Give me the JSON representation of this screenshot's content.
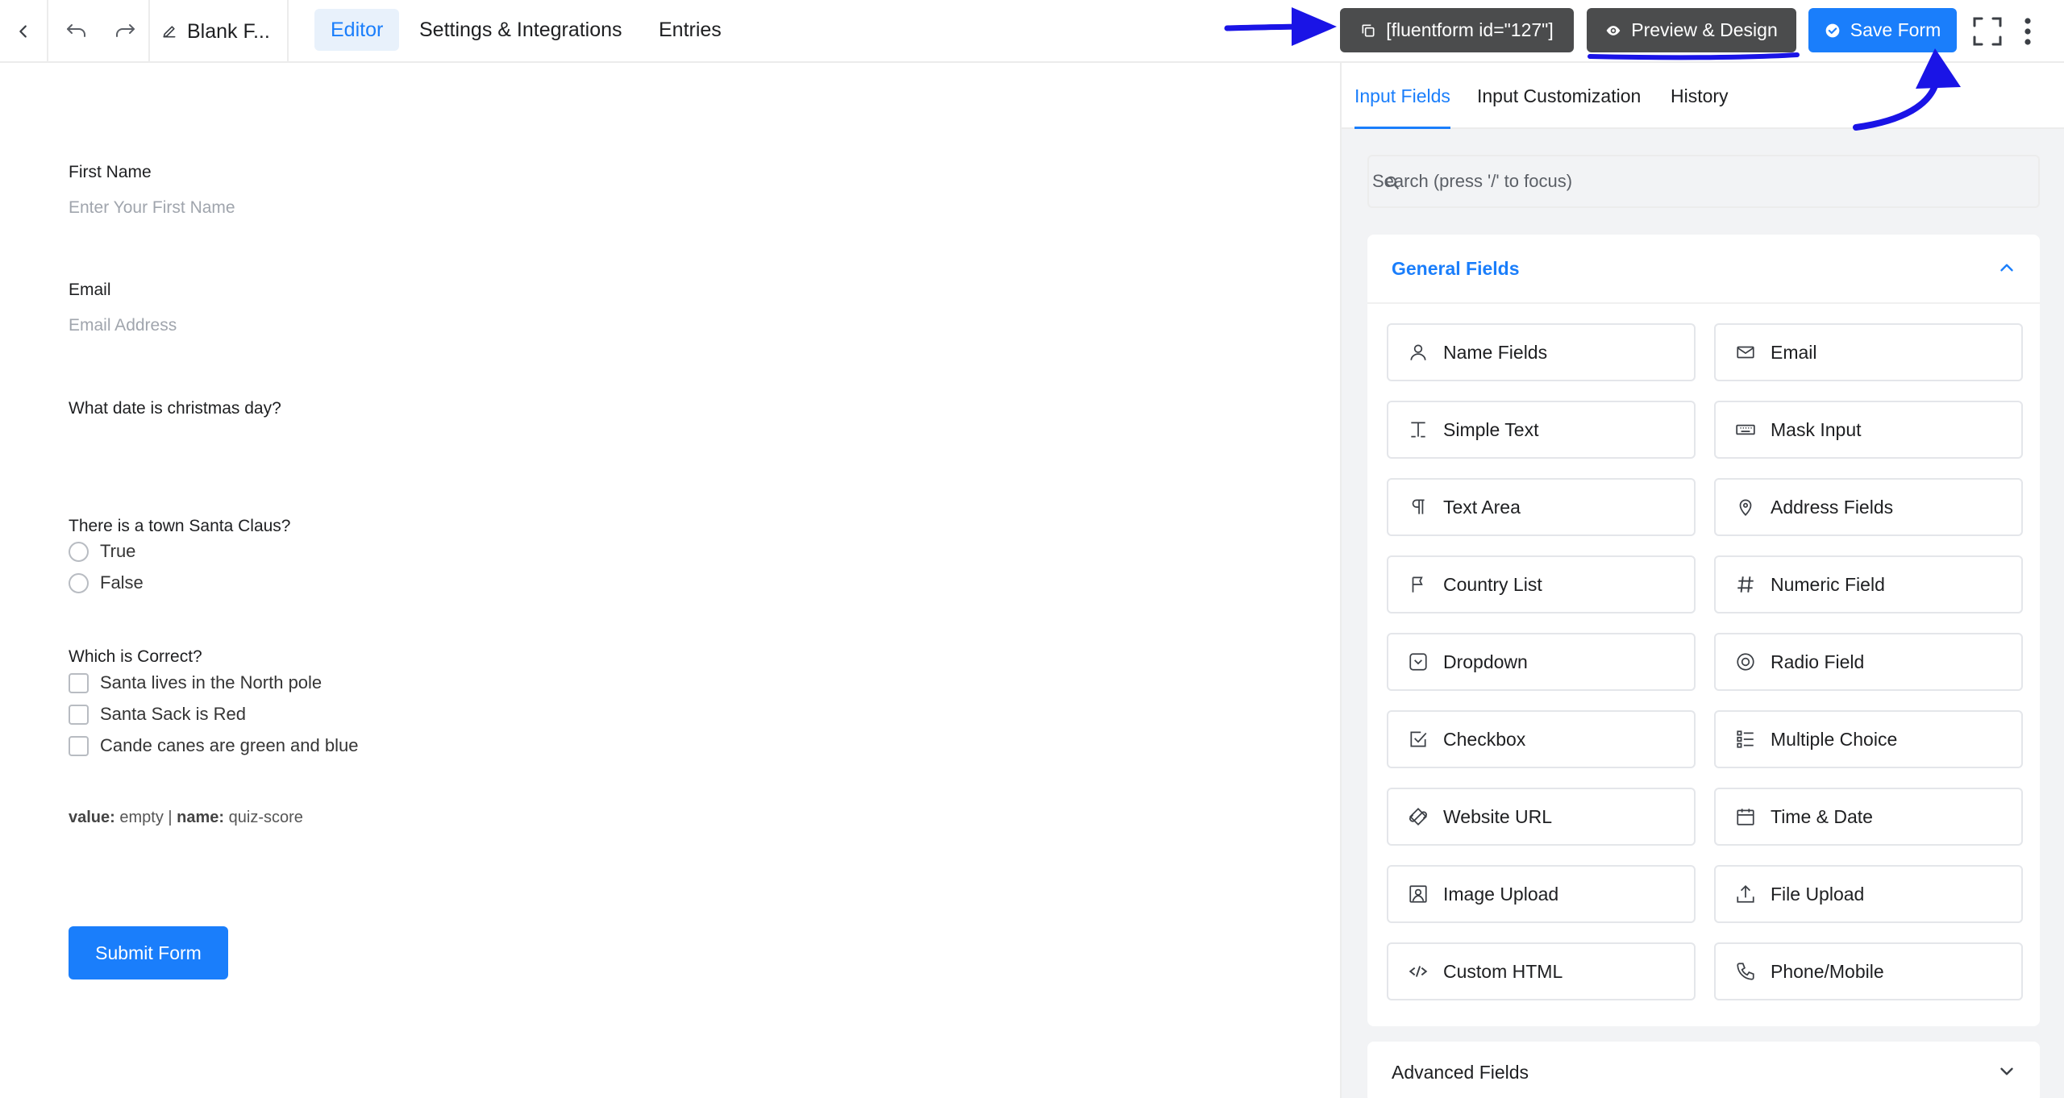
{
  "topbar": {
    "form_title": "Blank F...",
    "tabs": [
      {
        "label": "Editor"
      },
      {
        "label": "Settings & Integrations"
      },
      {
        "label": "Entries"
      }
    ],
    "shortcode": "[fluentform id=\"127\"]",
    "preview_label": "Preview & Design",
    "save_label": "Save Form"
  },
  "form": {
    "first_name": {
      "label": "First Name",
      "placeholder": "Enter Your First Name"
    },
    "email": {
      "label": "Email",
      "placeholder": "Email Address"
    },
    "date_question": {
      "label": "What date is christmas day?"
    },
    "radio_question": {
      "label": "There is a town Santa Claus?",
      "options": [
        "True",
        "False"
      ]
    },
    "checkbox_question": {
      "label": "Which is Correct?",
      "options": [
        "Santa lives in the North pole",
        "Santa Sack is Red",
        "Cande canes are green and blue"
      ]
    },
    "hidden_info": {
      "value_key": "value:",
      "value": "empty",
      "sep": "|",
      "name_key": "name:",
      "name": "quiz-score"
    },
    "submit_label": "Submit Form"
  },
  "sidebar": {
    "tabs": [
      {
        "label": "Input Fields"
      },
      {
        "label": "Input Customization"
      },
      {
        "label": "History"
      }
    ],
    "search_placeholder": "Search (press '/' to focus)",
    "general_title": "General Fields",
    "fields": [
      {
        "label": "Name Fields",
        "icon": "user-icon"
      },
      {
        "label": "Email",
        "icon": "envelope-icon"
      },
      {
        "label": "Simple Text",
        "icon": "text-cursor-icon"
      },
      {
        "label": "Mask Input",
        "icon": "keyboard-icon"
      },
      {
        "label": "Text Area",
        "icon": "paragraph-icon"
      },
      {
        "label": "Address Fields",
        "icon": "map-pin-icon"
      },
      {
        "label": "Country List",
        "icon": "flag-icon"
      },
      {
        "label": "Numeric Field",
        "icon": "hash-icon"
      },
      {
        "label": "Dropdown",
        "icon": "dropdown-icon"
      },
      {
        "label": "Radio Field",
        "icon": "radio-icon"
      },
      {
        "label": "Checkbox",
        "icon": "checkbox-icon"
      },
      {
        "label": "Multiple Choice",
        "icon": "list-icon"
      },
      {
        "label": "Website URL",
        "icon": "link-icon"
      },
      {
        "label": "Time & Date",
        "icon": "calendar-icon"
      },
      {
        "label": "Image Upload",
        "icon": "image-icon"
      },
      {
        "label": "File Upload",
        "icon": "upload-icon"
      },
      {
        "label": "Custom HTML",
        "icon": "code-icon"
      },
      {
        "label": "Phone/Mobile",
        "icon": "phone-icon"
      }
    ],
    "advanced_title": "Advanced Fields"
  },
  "colors": {
    "accent": "#1a7efb",
    "dark_button": "#4b4c4d",
    "annotation": "#1a14e6"
  }
}
